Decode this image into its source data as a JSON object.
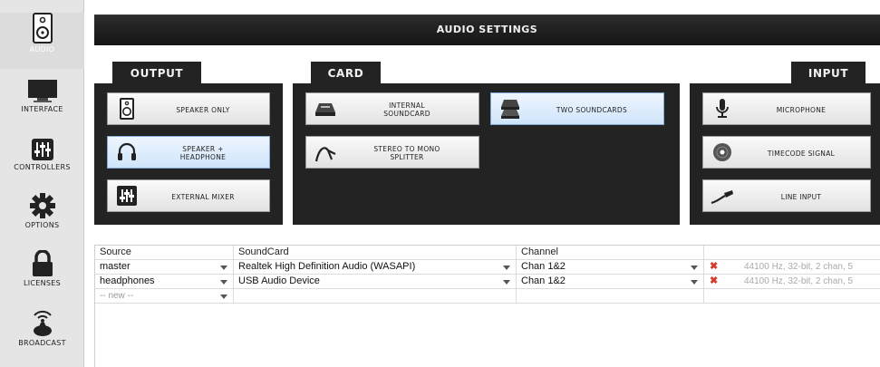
{
  "sidebar": {
    "items": [
      {
        "label": "AUDIO",
        "icon": "speaker-icon"
      },
      {
        "label": "INTERFACE",
        "icon": "monitor-icon"
      },
      {
        "label": "CONTROLLERS",
        "icon": "mixer-sliders-icon"
      },
      {
        "label": "OPTIONS",
        "icon": "gear-icon"
      },
      {
        "label": "LICENSES",
        "icon": "padlock-icon"
      },
      {
        "label": "BROADCAST",
        "icon": "broadcast-icon"
      }
    ]
  },
  "header": {
    "title": "AUDIO SETTINGS"
  },
  "output": {
    "tab": "OUTPUT",
    "buttons": [
      {
        "label": "SPEAKER ONLY",
        "icon": "speaker-icon"
      },
      {
        "label": "SPEAKER +\nHEADPHONE",
        "icon": "headphone-icon"
      },
      {
        "label": "EXTERNAL MIXER",
        "icon": "mixer-sliders-icon"
      }
    ]
  },
  "card": {
    "tab": "CARD",
    "buttons": [
      {
        "label": "INTERNAL\nSOUNDCARD",
        "icon": "soundcard-icon"
      },
      {
        "label": "TWO SOUNDCARDS",
        "icon": "two-soundcards-icon"
      },
      {
        "label": "STEREO TO MONO\nSPLITTER",
        "icon": "splitter-cable-icon"
      }
    ]
  },
  "input": {
    "tab": "INPUT",
    "buttons": [
      {
        "label": "MICROPHONE",
        "icon": "microphone-icon"
      },
      {
        "label": "TIMECODE SIGNAL",
        "icon": "vinyl-icon"
      },
      {
        "label": "LINE INPUT",
        "icon": "line-cable-icon"
      }
    ]
  },
  "table": {
    "headers": [
      "Source",
      "SoundCard",
      "Channel"
    ],
    "rows": [
      {
        "source": "master",
        "soundcard": "Realtek High Definition Audio (WASAPI)",
        "channel": "Chan 1&2",
        "format": "44100 Hz, 32-bit, 2 chan, 5"
      },
      {
        "source": "headphones",
        "soundcard": "USB Audio Device",
        "channel": "Chan 1&2",
        "format": "44100 Hz, 32-bit, 2 chan, 5"
      }
    ],
    "new_row": "-- new --",
    "remove_mark": "✖"
  },
  "colors": {
    "accent_selected": "#cfe4fa",
    "panel": "#232323",
    "remove": "#d63a2a"
  }
}
